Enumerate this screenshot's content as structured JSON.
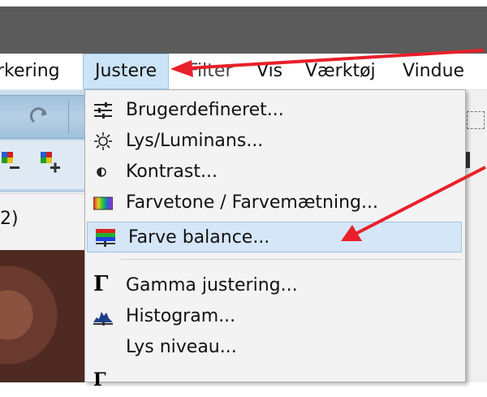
{
  "menubar": {
    "items": [
      {
        "label": "rkering"
      },
      {
        "label": "Justere"
      },
      {
        "label": "Filter"
      },
      {
        "label": "Vis"
      },
      {
        "label": "Værktøj"
      },
      {
        "label": "Vindue"
      }
    ]
  },
  "subheader": {
    "label": "2)"
  },
  "dropdown": {
    "items": [
      {
        "label": "Brugerdefineret...",
        "icon": "sliders-icon"
      },
      {
        "label": "Lys/Luminans...",
        "icon": "sun-icon"
      },
      {
        "label": "Kontrast...",
        "icon": "contrast-icon"
      },
      {
        "label": "Farvetone / Farvemætning...",
        "icon": "hue-saturation-icon"
      },
      {
        "label": "Farve balance...",
        "icon": "color-balance-icon"
      },
      {
        "label": "Gamma justering...",
        "icon": "gamma-icon"
      },
      {
        "label": "Histogram...",
        "icon": "histogram-icon"
      },
      {
        "label": "Lys niveau...",
        "icon": ""
      }
    ]
  },
  "colors": {
    "annotation_arrow": "#e8202a",
    "menu_highlight": "#cce4f7",
    "titlebar": "#5b5b5b"
  }
}
